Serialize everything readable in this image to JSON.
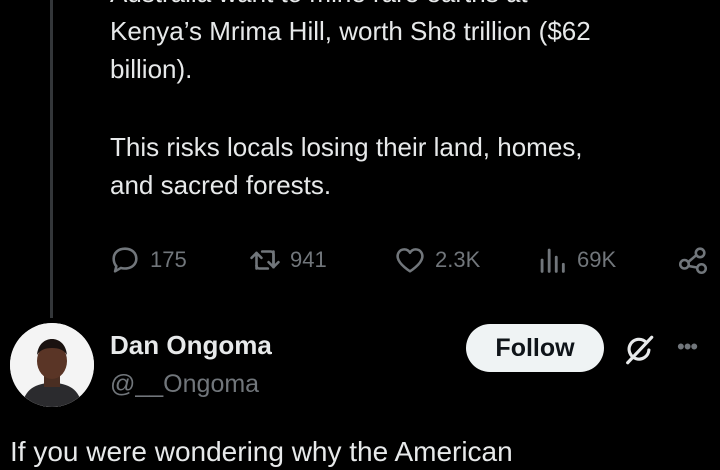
{
  "tweet": {
    "lines_top": [
      "Australia want to mine rare earths at",
      "Kenya’s Mrima Hill, worth Sh8 trillion ($62",
      "billion)."
    ],
    "lines_bottom": [
      "This risks locals losing their land, homes,",
      "and sacred forests."
    ]
  },
  "actions": {
    "replies": "175",
    "retweets": "941",
    "likes": "2.3K",
    "views": "69K"
  },
  "reply_user": {
    "name": "Dan Ongoma",
    "handle": "@__Ongoma",
    "follow_label": "Follow",
    "more_label": "•••",
    "text": "If you were wondering why the American"
  },
  "colors": {
    "background": "#000000",
    "text": "#e7e9ea",
    "muted": "#71767b",
    "button": "#eff3f4"
  },
  "icons": [
    "reply-icon",
    "retweet-icon",
    "like-icon",
    "views-icon",
    "share-icon",
    "grok-icon",
    "more-icon"
  ]
}
